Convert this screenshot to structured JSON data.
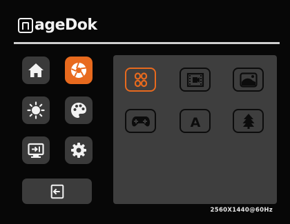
{
  "brand": {
    "logo_text": "ageDok"
  },
  "sidebar": {
    "items": [
      {
        "name": "home",
        "icon": "home-icon",
        "active": false
      },
      {
        "name": "picture-mode",
        "icon": "aperture-icon",
        "active": true
      },
      {
        "name": "brightness",
        "icon": "brightness-icon",
        "active": false
      },
      {
        "name": "color",
        "icon": "palette-icon",
        "active": false
      },
      {
        "name": "input-source",
        "icon": "input-source-icon",
        "active": false
      },
      {
        "name": "settings",
        "icon": "gear-icon",
        "active": false
      }
    ],
    "exit": {
      "icon": "exit-icon"
    }
  },
  "modes": [
    {
      "icon": "standard-grid-icon",
      "selected": true
    },
    {
      "icon": "movie-film-icon",
      "selected": false
    },
    {
      "icon": "photo-icon",
      "selected": false
    },
    {
      "icon": "gamepad-icon",
      "selected": false
    },
    {
      "label": "A",
      "icon": "auto-text-icon",
      "selected": false
    },
    {
      "icon": "tree-eco-icon",
      "selected": false
    }
  ],
  "status": {
    "resolution": "2560X1440@60Hz"
  },
  "colors": {
    "accent": "#e86a1e",
    "panel": "#3e3e3e",
    "button": "#3a3a3a",
    "background": "#070707"
  }
}
